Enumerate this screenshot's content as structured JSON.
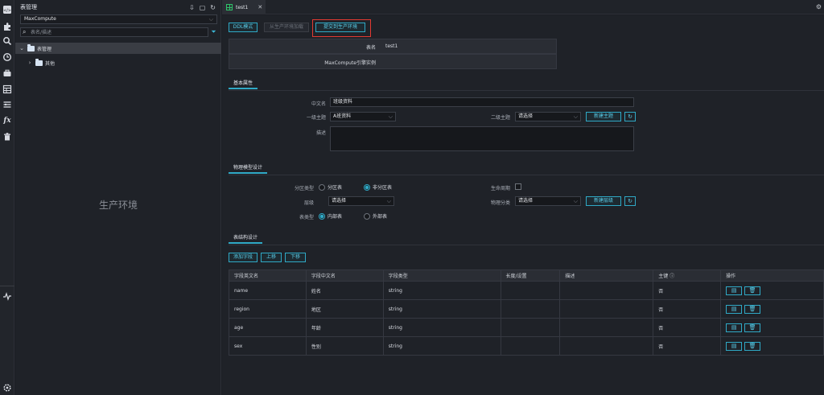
{
  "rail": {
    "icons": [
      "code-icon",
      "puzzle-icon",
      "search-icon",
      "clock-icon",
      "briefcase-icon",
      "table-icon",
      "list-settings-icon",
      "function-icon",
      "trash-icon",
      "pulse-icon",
      "settings-icon"
    ],
    "fx_label": "fx"
  },
  "tree": {
    "title": "表管理",
    "engine_select": "MaxCompute",
    "search_placeholder": "表名/描述",
    "items": [
      {
        "label": "表管理",
        "expanded": true
      },
      {
        "label": "其他",
        "expanded": false
      }
    ],
    "env_label": "生产环境"
  },
  "tabs": [
    {
      "label": "test1"
    }
  ],
  "toolbar": {
    "ddl_mode": "DDL模式",
    "load_from_prod": "从生产环境加载",
    "submit_to_prod": "提交到生产环境"
  },
  "info": {
    "table_name_label": "表名",
    "table_name_value": "test1",
    "engine_instance_label": "MaxCompute引擎实例"
  },
  "basic": {
    "section_title": "基本属性",
    "cn_name_label": "中文名",
    "cn_name_value": "班级资料",
    "level1_topic_label": "一级主题",
    "level1_topic_value": "A班资料",
    "level2_topic_label": "二级主题",
    "level2_topic_value": "请选择",
    "new_topic_button": "新建主题",
    "desc_label": "描述"
  },
  "physical": {
    "section_title": "物理模型设计",
    "partition_type_label": "分区类型",
    "partitioned_option": "分区表",
    "non_partitioned_option": "非分区表",
    "lifecycle_label": "生命周期",
    "layer_label": "层级",
    "layer_value": "请选择",
    "physical_category_label": "物理分类",
    "physical_category_value": "请选择",
    "new_layer_button": "新建层级",
    "table_type_label": "表类型",
    "internal_option": "内部表",
    "external_option": "外部表"
  },
  "structure": {
    "section_title": "表结构设计",
    "add_field_button": "添加字段",
    "move_up_button": "上移",
    "move_down_button": "下移",
    "columns": [
      "字段英文名",
      "字段中文名",
      "字段类型",
      "长度/设置",
      "描述",
      "主键 ⓘ",
      "操作"
    ],
    "rows": [
      {
        "en": "name",
        "cn": "姓名",
        "type": "string",
        "length": "",
        "desc": "",
        "pk": "否"
      },
      {
        "en": "region",
        "cn": "地区",
        "type": "string",
        "length": "",
        "desc": "",
        "pk": "否"
      },
      {
        "en": "age",
        "cn": "年龄",
        "type": "string",
        "length": "",
        "desc": "",
        "pk": "否"
      },
      {
        "en": "sex",
        "cn": "性别",
        "type": "string",
        "length": "",
        "desc": "",
        "pk": "否"
      }
    ]
  },
  "colors": {
    "accent": "#2fa9c6",
    "highlight_box": "#e23a32",
    "background": "#1f2228"
  }
}
